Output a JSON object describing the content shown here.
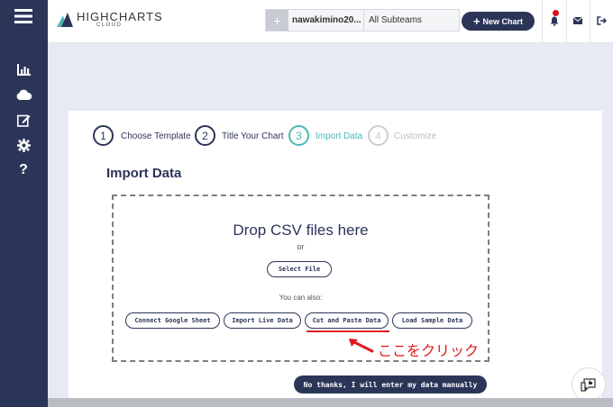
{
  "app": {
    "logo_main": "HIGHCHARTS",
    "logo_sub": "CLOUD"
  },
  "sidebar": {
    "items": [
      {
        "icon": "hamburger-icon"
      },
      {
        "icon": "bar-chart-icon"
      },
      {
        "icon": "cloud-icon"
      },
      {
        "icon": "edit-icon"
      },
      {
        "icon": "gear-icon"
      },
      {
        "icon": "help-icon"
      }
    ]
  },
  "topbar": {
    "team_add": "+",
    "team_name": "nawakimino20...",
    "subteam": "All Subteams",
    "new_chart": "New Chart"
  },
  "steps": [
    {
      "num": "1",
      "label": "Choose Template"
    },
    {
      "num": "2",
      "label": "Title Your Chart"
    },
    {
      "num": "3",
      "label": "Import Data"
    },
    {
      "num": "4",
      "label": "Customize"
    }
  ],
  "import": {
    "title": "Import Data",
    "drop_title": "Drop CSV files here",
    "or": "or",
    "select_file": "Select File",
    "also": "You can also:",
    "options": [
      "Connect Google Sheet",
      "Import Live Data",
      "Cut and Paste Data",
      "Load Sample Data"
    ],
    "manual": "No thanks, I will enter my data manually"
  },
  "annotation": {
    "text": "ここをクリック",
    "color": "#e0191a"
  },
  "colors": {
    "navy": "#2b3558",
    "teal": "#49b9b4",
    "gray": "#c9cdd3",
    "red": "#e0101a",
    "background": "#e7eaf2"
  }
}
